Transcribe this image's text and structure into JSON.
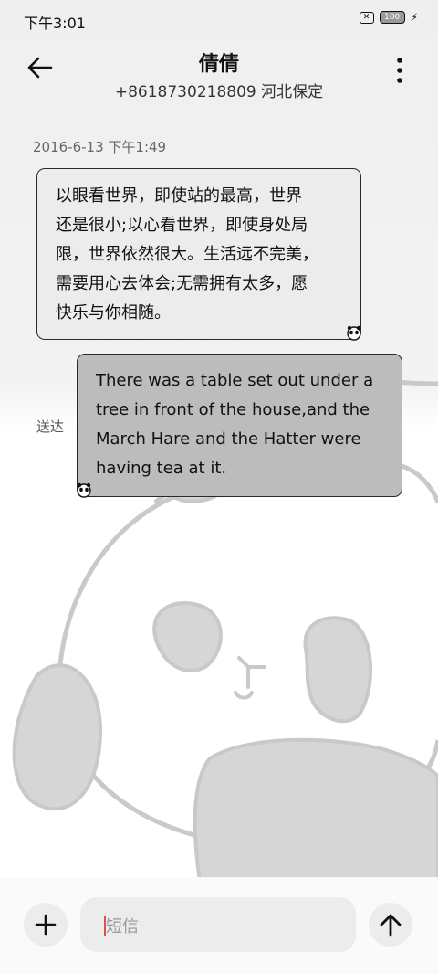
{
  "status_bar": {
    "time": "下午3:01",
    "battery_level": "100",
    "sim_icon": "sim-off-icon",
    "charging_icon": "charging-bolt-icon"
  },
  "header": {
    "title": "倩倩",
    "subtitle": "+8618730218809 河北保定",
    "back_icon": "back-arrow-icon",
    "more_icon": "more-vertical-icon"
  },
  "conversation": {
    "timestamp": "2016-6-13 下午1:49",
    "messages": [
      {
        "direction": "incoming",
        "lines": [
          "以眼看世界，即使站的最高，世界",
          "还是很小;以心看世界，即使身处局",
          "限，世界依然很大。生活远不完美，",
          "需要用心去体会;无需拥有太多，愿",
          "快乐与你相随。"
        ]
      },
      {
        "direction": "outgoing",
        "lines": [
          "There was a table set out under a",
          "tree in front of the house,and the",
          "March Hare and the Hatter were",
          "having tea at it."
        ],
        "status": "送达"
      }
    ]
  },
  "compose": {
    "placeholder": "短信",
    "add_icon": "plus-icon",
    "send_icon": "send-arrow-up-icon"
  },
  "colors": {
    "incoming_bubble": "#ececec",
    "outgoing_bubble": "#bcbcbc",
    "bubble_border": "#2a2a2a",
    "wallpaper_panda": "#d6d6d6"
  }
}
